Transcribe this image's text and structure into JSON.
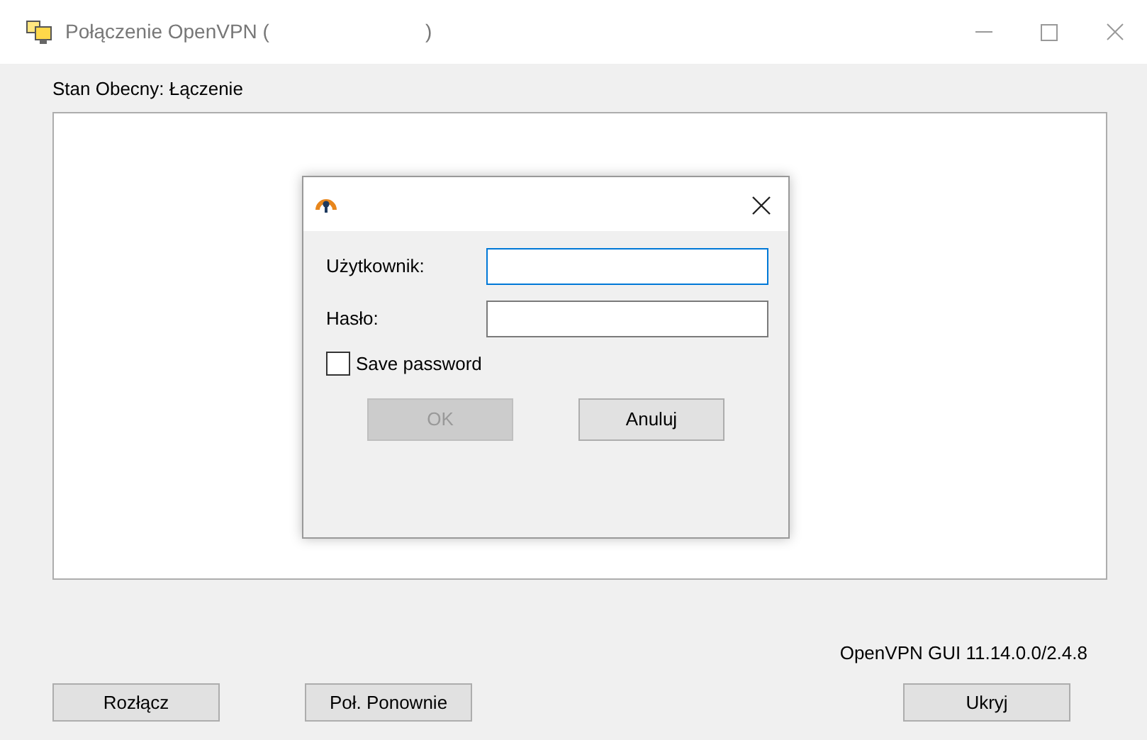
{
  "window": {
    "title": "Połączenie OpenVPN (",
    "title_end": ")"
  },
  "status": "Stan Obecny: Łączenie",
  "dialog": {
    "fields": [
      {
        "label": "Użytkownik:",
        "focused": true
      },
      {
        "label": "Hasło:",
        "focused": false
      }
    ],
    "checkbox": {
      "label": "Save password",
      "checked": false
    },
    "buttons": [
      {
        "label": "OK",
        "disabled": true
      },
      {
        "label": "Anuluj",
        "disabled": false
      }
    ]
  },
  "version": "OpenVPN GUI 11.14.0.0/2.4.8",
  "buttons": [
    "Rozłącz",
    "Poł. Ponownie",
    "Ukryj"
  ]
}
